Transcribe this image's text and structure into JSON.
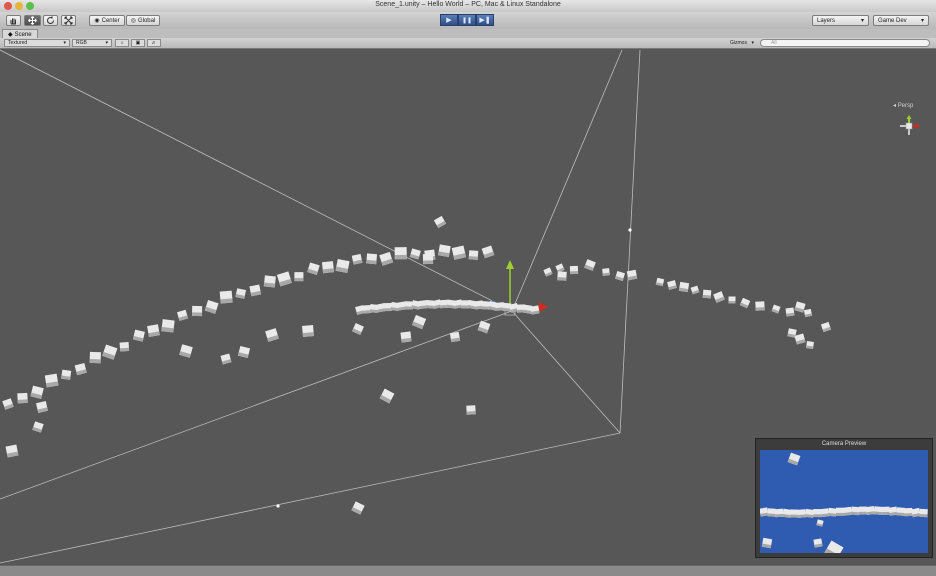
{
  "window": {
    "title": "Scene_1.unity – Hello World – PC, Mac & Linux Standalone",
    "traffic_light_colors": [
      "#e4554a",
      "#e6b43a",
      "#5cbf4a"
    ]
  },
  "toolbar": {
    "tools": [
      "hand-tool",
      "move-tool",
      "rotate-tool",
      "scale-tool"
    ],
    "pivot_label": "Center",
    "space_label": "Global",
    "play_controls": [
      "play",
      "pause",
      "step"
    ],
    "layers_label": "Layers",
    "layout_label": "Game Dev"
  },
  "tabs": {
    "scene_label": "Scene"
  },
  "scene_bar": {
    "render_mode": "Textured",
    "color_mode": "RGB",
    "gizmos_label": "Gizmos",
    "search_placeholder": "All"
  },
  "viewport": {
    "projection_label": "Persp",
    "background": "#575757"
  },
  "camera_preview": {
    "title": "Camera Preview",
    "background": "#2f5bb0"
  }
}
